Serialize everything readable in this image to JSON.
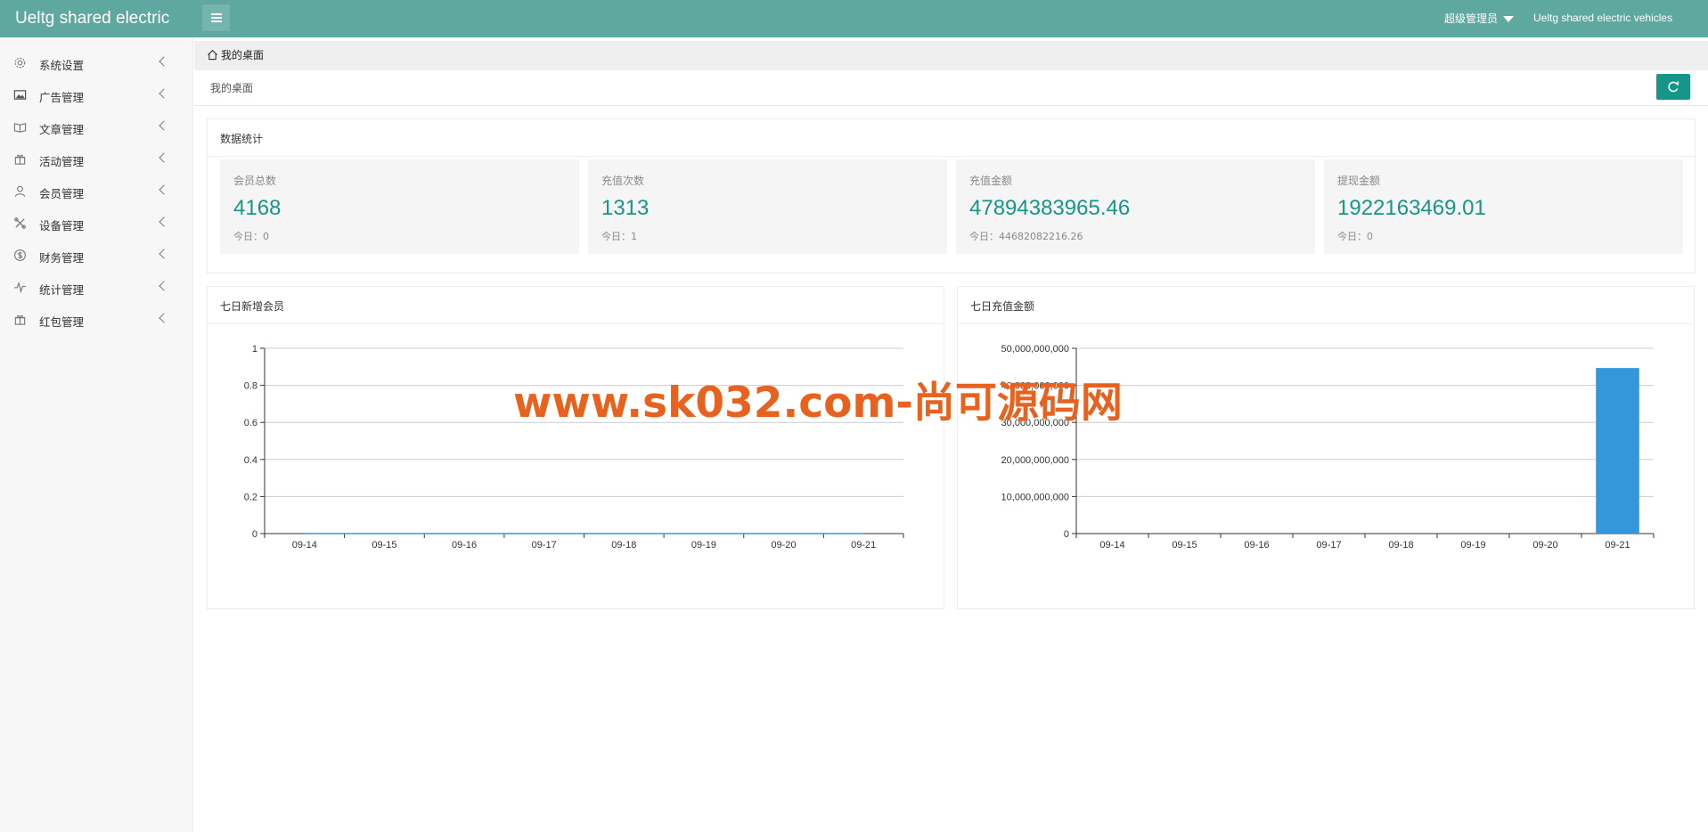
{
  "header": {
    "app_title": "Ueltg shared electric",
    "user_label": "超级管理员",
    "site_link": "Ueltg shared electric vehicles"
  },
  "sidebar": {
    "items": [
      {
        "label": "系统设置",
        "icon": "gear-icon"
      },
      {
        "label": "广告管理",
        "icon": "image-icon"
      },
      {
        "label": "文章管理",
        "icon": "book-icon"
      },
      {
        "label": "活动管理",
        "icon": "gift-icon"
      },
      {
        "label": "会员管理",
        "icon": "user-icon"
      },
      {
        "label": "设备管理",
        "icon": "tools-icon"
      },
      {
        "label": "财务管理",
        "icon": "dollar-icon"
      },
      {
        "label": "统计管理",
        "icon": "pulse-icon"
      },
      {
        "label": "红包管理",
        "icon": "gift-icon"
      }
    ]
  },
  "tabs": {
    "home_label": "我的桌面"
  },
  "page": {
    "breadcrumb": "我的桌面"
  },
  "stats_card": {
    "title": "数据统计",
    "items": [
      {
        "label": "会员总数",
        "value": "4168",
        "today": "今日：0"
      },
      {
        "label": "充值次数",
        "value": "1313",
        "today": "今日：1"
      },
      {
        "label": "充值金额",
        "value": "47894383965.46",
        "today": "今日：44682082216.26"
      },
      {
        "label": "提现金额",
        "value": "1922163469.01",
        "today": "今日：0"
      }
    ]
  },
  "watermark": "www.sk032.com-尚可源码网",
  "colors": {
    "header": "#5fa8a0",
    "accent": "#159688",
    "bar": "#3398db"
  },
  "chart_data": [
    {
      "type": "line",
      "title": "七日新增会员",
      "categories": [
        "09-14",
        "09-15",
        "09-16",
        "09-17",
        "09-18",
        "09-19",
        "09-20",
        "09-21"
      ],
      "values": [
        0,
        0,
        0,
        0,
        0,
        0,
        0,
        0
      ],
      "ylim": [
        0,
        1
      ],
      "yticks": [
        "0",
        "0.2",
        "0.4",
        "0.6",
        "0.8",
        "1"
      ],
      "grid": true
    },
    {
      "type": "bar",
      "title": "七日充值金额",
      "categories": [
        "09-14",
        "09-15",
        "09-16",
        "09-17",
        "09-18",
        "09-19",
        "09-20",
        "09-21"
      ],
      "values": [
        0,
        0,
        0,
        0,
        0,
        0,
        0,
        44682082216.26
      ],
      "ylim": [
        0,
        50000000000
      ],
      "yticks": [
        "0",
        "10,000,000,000",
        "20,000,000,000",
        "30,000,000,000",
        "40,000,000,000",
        "50,000,000,000"
      ],
      "grid": true
    }
  ]
}
